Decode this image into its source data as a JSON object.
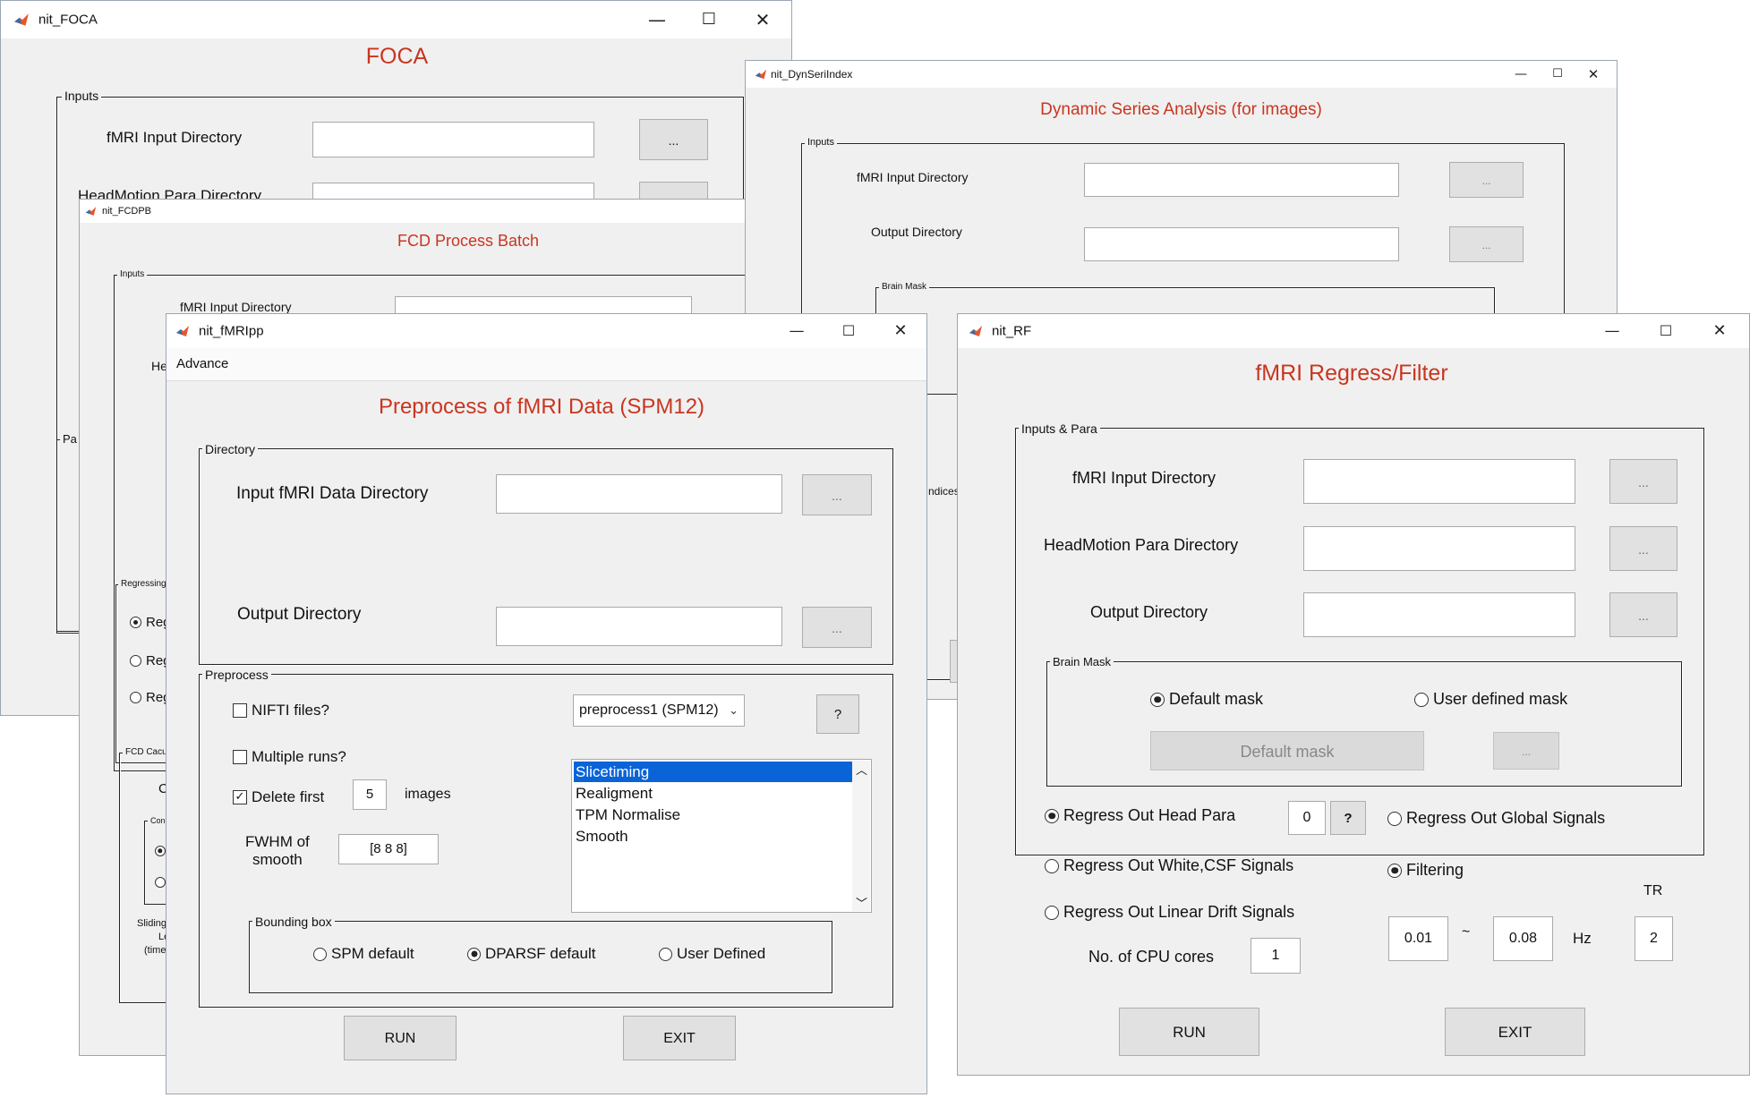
{
  "foca": {
    "window_title": "nit_FOCA",
    "heading": "FOCA",
    "inputs_legend": "Inputs",
    "fmri_input_label": "fMRI Input Directory",
    "headmotion_label": "HeadMotion Para Directory",
    "browse_label": "...",
    "para_legend": "Pa"
  },
  "dynseri": {
    "window_title": "nit_DynSeriIndex",
    "heading": "Dynamic Series Analysis (for images)",
    "inputs_legend": "Inputs",
    "fmri_input_label": "fMRI Input Directory",
    "output_label": "Output Directory",
    "brain_mask_legend": "Brain Mask",
    "browse_label": "...",
    "indices_fragment": "ndices"
  },
  "fcdpb": {
    "window_title": "nit_FCDPB",
    "heading": "FCD Process Batch",
    "inputs_legend": "Inputs",
    "fmri_input_label": "fMRI Input Directory",
    "he_fragment": "He",
    "regressing_legend": "Regressing",
    "reg_fragment": "Reg",
    "fcd_calc_legend": "FCD Cacu",
    "c_fragment": "C",
    "con_legend": "Con",
    "sliding_lines": [
      "Sliding",
      "Le",
      "(time"
    ]
  },
  "fmripp": {
    "window_title": "nit_fMRIpp",
    "menu_advance": "Advance",
    "heading": "Preprocess of fMRI Data (SPM12)",
    "directory_legend": "Directory",
    "input_dir_label": "Input fMRI Data Directory",
    "output_dir_label": "Output Directory",
    "browse_label": "...",
    "preprocess_legend": "Preprocess",
    "nifti_label": "NIFTI files?",
    "multiple_runs_label": "Multiple runs?",
    "delete_first_label": "Delete first",
    "delete_first_value": "5",
    "images_label": "images",
    "fwhm_label_line1": "FWHM of",
    "fwhm_label_line2": "smooth",
    "fwhm_value": "[8 8 8]",
    "pipeline_select": "preprocess1 (SPM12)",
    "help_label": "?",
    "steps": [
      "Slicetiming",
      "Realigment",
      "TPM Normalise",
      "Smooth"
    ],
    "selected_step": "Slicetiming",
    "bounding_legend": "Bounding box",
    "bbox_spm": "SPM default",
    "bbox_dparsf": "DPARSF default",
    "bbox_user": "User Defined",
    "run_label": "RUN",
    "exit_label": "EXIT"
  },
  "rf": {
    "window_title": "nit_RF",
    "heading": "fMRI Regress/Filter",
    "inputs_legend": "Inputs & Para",
    "fmri_input_label": "fMRI Input Directory",
    "headmotion_label": "HeadMotion Para Directory",
    "output_label": "Output Directory",
    "browse_label": "...",
    "brain_mask_legend": "Brain Mask",
    "default_mask_radio": "Default mask",
    "user_mask_radio": "User defined mask",
    "default_mask_button": "Default mask",
    "regress_head": "Regress Out Head Para",
    "head_para_value": "0",
    "help_label": "?",
    "regress_global": "Regress Out Global Signals",
    "regress_wm": "Regress Out White,CSF Signals",
    "filtering": "Filtering",
    "regress_drift": "Regress Out Linear Drift Signals",
    "tr_label": "TR",
    "low_freq": "0.01",
    "tilde": "~",
    "high_freq": "0.08",
    "hz_label": "Hz",
    "tr_value": "2",
    "cpu_label": "No. of CPU cores",
    "cpu_value": "1",
    "run_label": "RUN",
    "exit_label": "EXIT"
  }
}
